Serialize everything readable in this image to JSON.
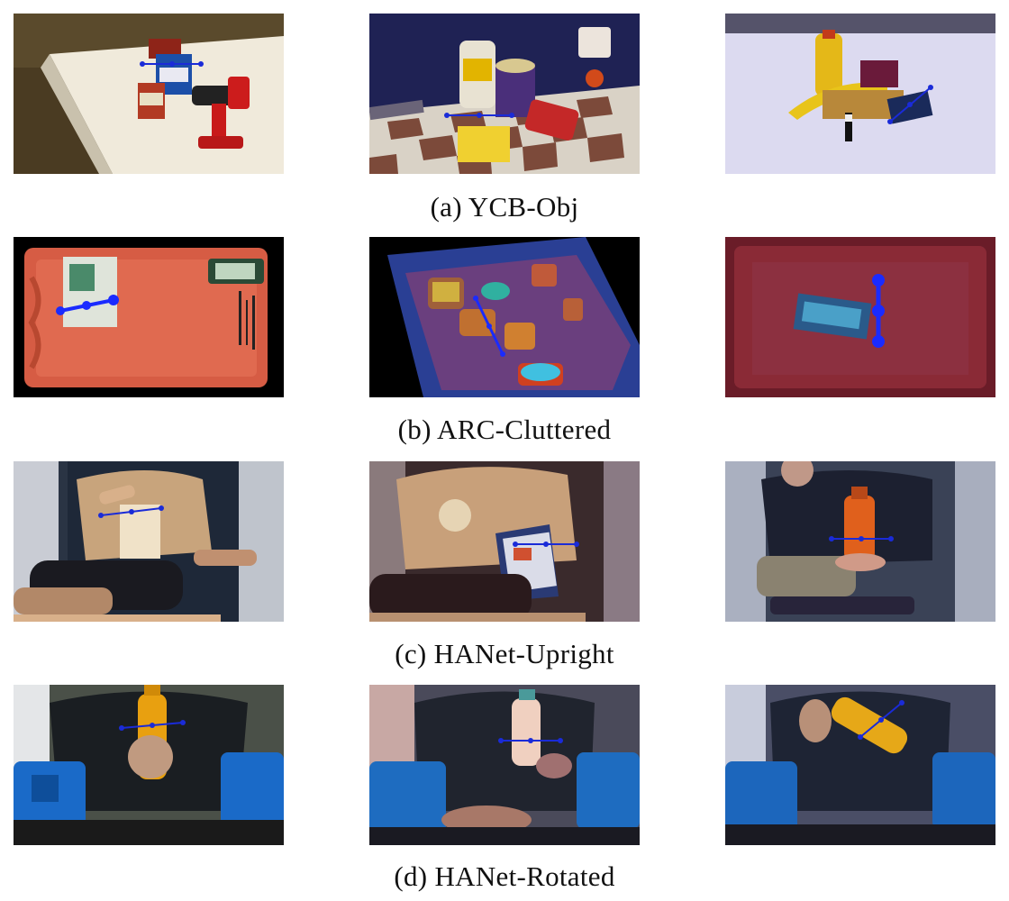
{
  "captions": [
    "(a)  YCB-Obj",
    "(b)  ARC-Cluttered",
    "(c)  HANet-Upright",
    "(d)  HANet-Rotated"
  ]
}
